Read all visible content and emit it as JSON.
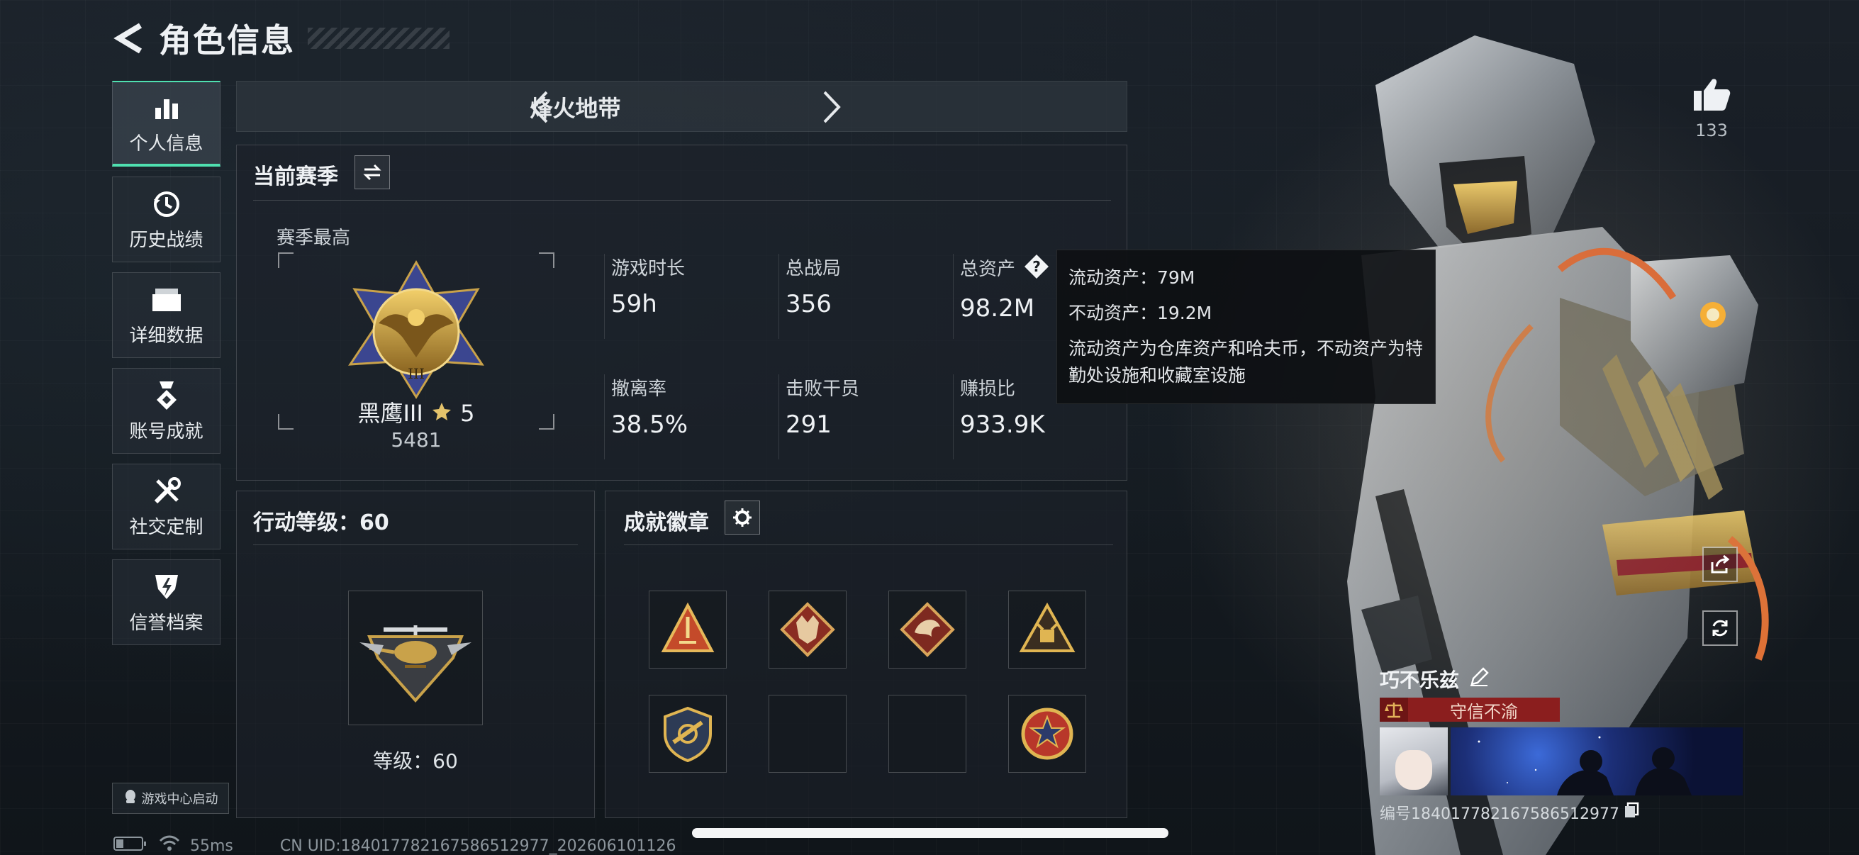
{
  "header": {
    "title": "角色信息"
  },
  "sidebar": {
    "items": [
      {
        "label": "个人信息",
        "icon": "bar-chart-icon",
        "active": true
      },
      {
        "label": "历史战绩",
        "icon": "history-clock-icon"
      },
      {
        "label": "详细数据",
        "icon": "folder-icon"
      },
      {
        "label": "账号成就",
        "icon": "medal-icon"
      },
      {
        "label": "社交定制",
        "icon": "tools-icon"
      },
      {
        "label": "信誉档案",
        "icon": "lightning-shield-icon"
      }
    ],
    "game_center": "游戏中心启动"
  },
  "mode": {
    "title": "烽火地带"
  },
  "season": {
    "title": "当前赛季",
    "best_label": "赛季最高",
    "rank_name": "黑鹰III",
    "rank_stars": "5",
    "rank_score": "5481",
    "stats": [
      {
        "key": "游戏时长",
        "value": "59h"
      },
      {
        "key": "总战局",
        "value": "356"
      },
      {
        "key": "总资产",
        "value": "98.2M"
      },
      {
        "key": "撤离率",
        "value": "38.5%"
      },
      {
        "key": "击败干员",
        "value": "291"
      },
      {
        "key": "赚损比",
        "value": "933.9K"
      }
    ]
  },
  "tooltip": {
    "liquid": "流动资产：79M",
    "fixed": "不动资产：19.2M",
    "desc": "流动资产为仓库资产和哈夫币，不动资产为特勤处设施和收藏室设施"
  },
  "level": {
    "title": "行动等级：60",
    "label": "等级：60"
  },
  "badges": {
    "title": "成就徽章",
    "slots": [
      "warning-triangle-badge",
      "wolf-badge",
      "dragon-badge",
      "fist-triangle-badge",
      "shield-badge",
      "empty",
      "empty",
      "star-medal-badge"
    ]
  },
  "likes": {
    "count": "133"
  },
  "player": {
    "name": "巧不乐兹",
    "credit": "守信不渝",
    "id": "编号18401778216758​6512977"
  },
  "status": {
    "ping": "55ms",
    "uid": "CN UID:184017782167586512977_202606101126"
  },
  "colors": {
    "accent": "#4fe0b0",
    "credit_red": "#8b1e1e",
    "gold": "#c9a24a"
  }
}
